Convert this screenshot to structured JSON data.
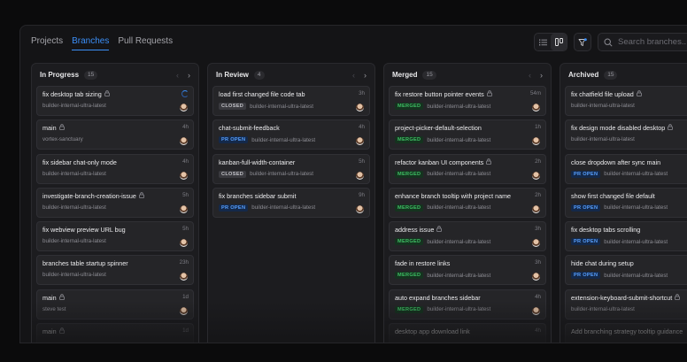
{
  "nav": {
    "tabs": [
      {
        "label": "Projects"
      },
      {
        "label": "Branches"
      },
      {
        "label": "Pull Requests"
      }
    ]
  },
  "toolbar": {
    "search_placeholder": "Search branches..."
  },
  "colors": {
    "accent": "#3b8ef6",
    "merged": "#3fbf65",
    "pr_open": "#58a0ff",
    "closed": "#c2c2c7"
  },
  "columns": [
    {
      "title": "In Progress",
      "count": "15",
      "cards": [
        {
          "title": "fix desktop tab sizing",
          "lock": true,
          "time": "",
          "spinner": true,
          "badge": "",
          "badge_type": "",
          "sub": "builder-internal-ultra-latest",
          "avatar": true
        },
        {
          "title": "main",
          "lock": true,
          "time": "4h",
          "badge": "",
          "badge_type": "",
          "sub": "vortex-sanctuary",
          "avatar": true
        },
        {
          "title": "fix sidebar chat-only mode",
          "lock": false,
          "time": "4h",
          "badge": "",
          "badge_type": "",
          "sub": "builder-internal-ultra-latest",
          "avatar": true
        },
        {
          "title": "investigate-branch-creation-issue",
          "lock": true,
          "time": "5h",
          "badge": "",
          "badge_type": "",
          "sub": "builder-internal-ultra-latest",
          "avatar": true
        },
        {
          "title": "fix webview preview URL bug",
          "lock": false,
          "time": "5h",
          "badge": "",
          "badge_type": "",
          "sub": "builder-internal-ultra-latest",
          "avatar": true
        },
        {
          "title": "branches table startup spinner",
          "lock": false,
          "time": "23h",
          "badge": "",
          "badge_type": "",
          "sub": "builder-internal-ultra-latest",
          "avatar": true
        },
        {
          "title": "main",
          "lock": true,
          "time": "1d",
          "badge": "",
          "badge_type": "",
          "sub": "steve test",
          "avatar": true
        },
        {
          "title": "main",
          "lock": true,
          "time": "1d",
          "badge": "",
          "badge_type": "",
          "sub": "",
          "avatar": false
        }
      ]
    },
    {
      "title": "In Review",
      "count": "4",
      "cards": [
        {
          "title": "load first changed file code tab",
          "lock": false,
          "time": "3h",
          "badge": "CLOSED",
          "badge_type": "closed",
          "sub": "builder-internal-ultra-latest",
          "avatar": true
        },
        {
          "title": "chat-submit-feedback",
          "lock": false,
          "time": "4h",
          "badge": "PR OPEN",
          "badge_type": "pr-open",
          "sub": "builder-internal-ultra-latest",
          "avatar": true
        },
        {
          "title": "kanban-full-width-container",
          "lock": false,
          "time": "5h",
          "badge": "CLOSED",
          "badge_type": "closed",
          "sub": "builder-internal-ultra-latest",
          "avatar": true
        },
        {
          "title": "fix branches sidebar submit",
          "lock": false,
          "time": "9h",
          "badge": "PR OPEN",
          "badge_type": "pr-open",
          "sub": "builder-internal-ultra-latest",
          "avatar": true
        }
      ]
    },
    {
      "title": "Merged",
      "count": "15",
      "cards": [
        {
          "title": "fix restore button pointer events",
          "lock": true,
          "time": "54m",
          "badge": "MERGED",
          "badge_type": "merged",
          "sub": "builder-internal-ultra-latest",
          "avatar": true
        },
        {
          "title": "project-picker-default-selection",
          "lock": false,
          "time": "1h",
          "badge": "MERGED",
          "badge_type": "merged",
          "sub": "builder-internal-ultra-latest",
          "avatar": true
        },
        {
          "title": "refactor kanban UI components",
          "lock": true,
          "time": "2h",
          "badge": "MERGED",
          "badge_type": "merged",
          "sub": "builder-internal-ultra-latest",
          "avatar": true
        },
        {
          "title": "enhance branch tooltip with project name",
          "lock": false,
          "time": "2h",
          "badge": "MERGED",
          "badge_type": "merged",
          "sub": "builder-internal-ultra-latest",
          "avatar": true
        },
        {
          "title": "address issue",
          "lock": true,
          "time": "3h",
          "badge": "MERGED",
          "badge_type": "merged",
          "sub": "builder-internal-ultra-latest",
          "avatar": true
        },
        {
          "title": "fade in restore links",
          "lock": false,
          "time": "3h",
          "badge": "MERGED",
          "badge_type": "merged",
          "sub": "builder-internal-ultra-latest",
          "avatar": true
        },
        {
          "title": "auto expand branches sidebar",
          "lock": false,
          "time": "4h",
          "badge": "MERGED",
          "badge_type": "merged",
          "sub": "builder-internal-ultra-latest",
          "avatar": true
        },
        {
          "title": "desktop app download link",
          "lock": false,
          "time": "4h",
          "badge": "",
          "badge_type": "",
          "sub": "",
          "avatar": false
        }
      ]
    },
    {
      "title": "Archived",
      "count": "15",
      "cards": [
        {
          "title": "fix chatfield file upload",
          "lock": true,
          "time": "",
          "badge": "",
          "badge_type": "",
          "sub": "builder-internal-ultra-latest",
          "avatar": false
        },
        {
          "title": "fix design mode disabled desktop",
          "lock": true,
          "time": "",
          "badge": "",
          "badge_type": "",
          "sub": "builder-internal-ultra-latest",
          "avatar": false
        },
        {
          "title": "close dropdown after sync main",
          "lock": false,
          "time": "",
          "badge": "PR OPEN",
          "badge_type": "pr-open",
          "sub": "builder-internal-ultra-latest",
          "avatar": false
        },
        {
          "title": "show first changed file default",
          "lock": false,
          "time": "",
          "badge": "PR OPEN",
          "badge_type": "pr-open",
          "sub": "builder-internal-ultra-latest",
          "avatar": false
        },
        {
          "title": "fix desktop tabs scrolling",
          "lock": false,
          "time": "",
          "badge": "PR OPEN",
          "badge_type": "pr-open",
          "sub": "builder-internal-ultra-latest",
          "avatar": false
        },
        {
          "title": "hide chat during setup",
          "lock": false,
          "time": "",
          "badge": "PR OPEN",
          "badge_type": "pr-open",
          "sub": "builder-internal-ultra-latest",
          "avatar": false
        },
        {
          "title": "extension-keyboard-submit-shortcut",
          "lock": true,
          "time": "",
          "badge": "",
          "badge_type": "",
          "sub": "builder-internal-ultra-latest",
          "avatar": false
        },
        {
          "title": "Add branching strategy tooltip guidance",
          "lock": false,
          "time": "",
          "badge": "",
          "badge_type": "",
          "sub": "",
          "avatar": false
        }
      ]
    }
  ]
}
